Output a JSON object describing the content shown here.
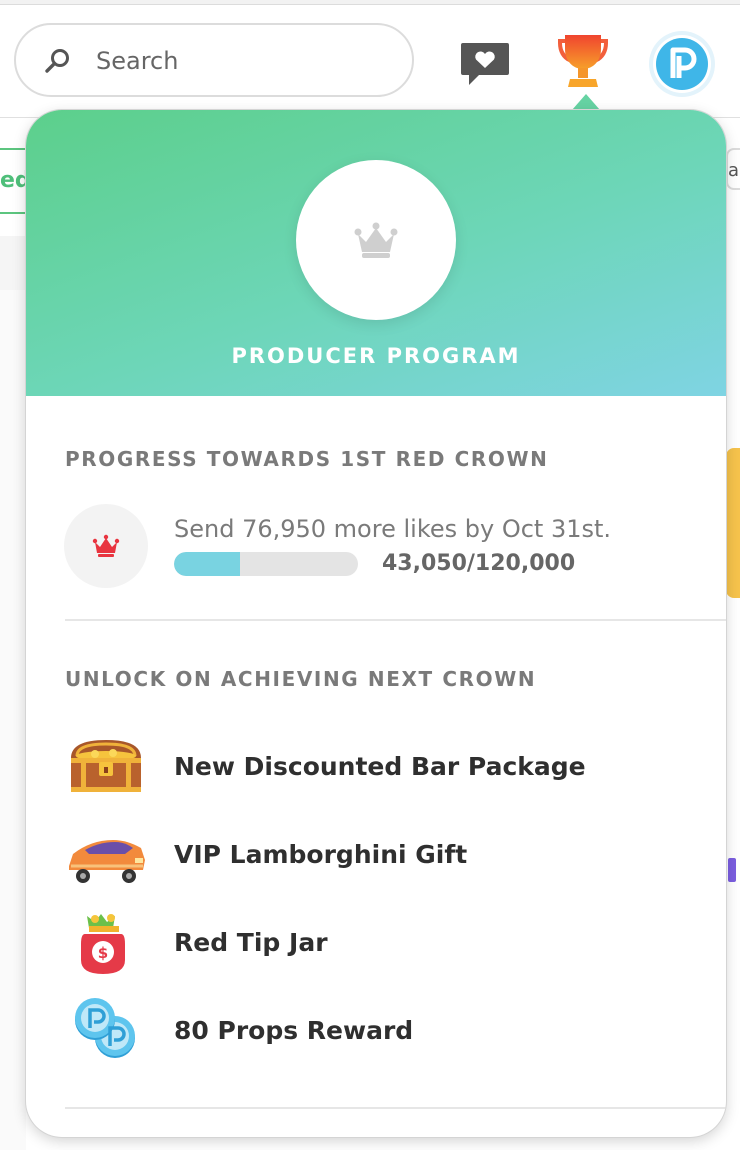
{
  "topbar": {
    "search": {
      "placeholder": "Search",
      "value": ""
    },
    "icons": [
      "search-icon",
      "message-heart-icon",
      "trophy-icon",
      "props-avatar-icon"
    ]
  },
  "background": {
    "left_tab_fragment": "ed",
    "right_tab_fragment": "ai"
  },
  "popover": {
    "header": {
      "title": "PRODUCER PROGRAM",
      "badge_icon": "crown-icon"
    },
    "progress": {
      "heading": "PROGRESS TOWARDS 1ST RED CROWN",
      "message": "Send 76,950 more likes by Oct 31st.",
      "count_text": "43,050/120,000",
      "current": 43050,
      "goal": 120000,
      "fraction": 0.3588
    },
    "unlock": {
      "heading": "UNLOCK ON ACHIEVING NEXT CROWN",
      "items": [
        {
          "label": "New Discounted Bar Package",
          "icon": "treasure-chest-icon"
        },
        {
          "label": "VIP Lamborghini Gift",
          "icon": "sports-car-icon"
        },
        {
          "label": "Red Tip Jar",
          "icon": "tip-jar-icon"
        },
        {
          "label": "80 Props Reward",
          "icon": "props-coins-icon"
        }
      ]
    }
  },
  "colors": {
    "header_gradient_start": "#5ccf8b",
    "header_gradient_end": "#7fd4e3",
    "progress_fill": "#79d3e1",
    "progress_track": "#e4e4e4",
    "trophy": "#f25f3c",
    "avatar_blue": "#3fb6e8",
    "crown_red": "#e8343f"
  }
}
